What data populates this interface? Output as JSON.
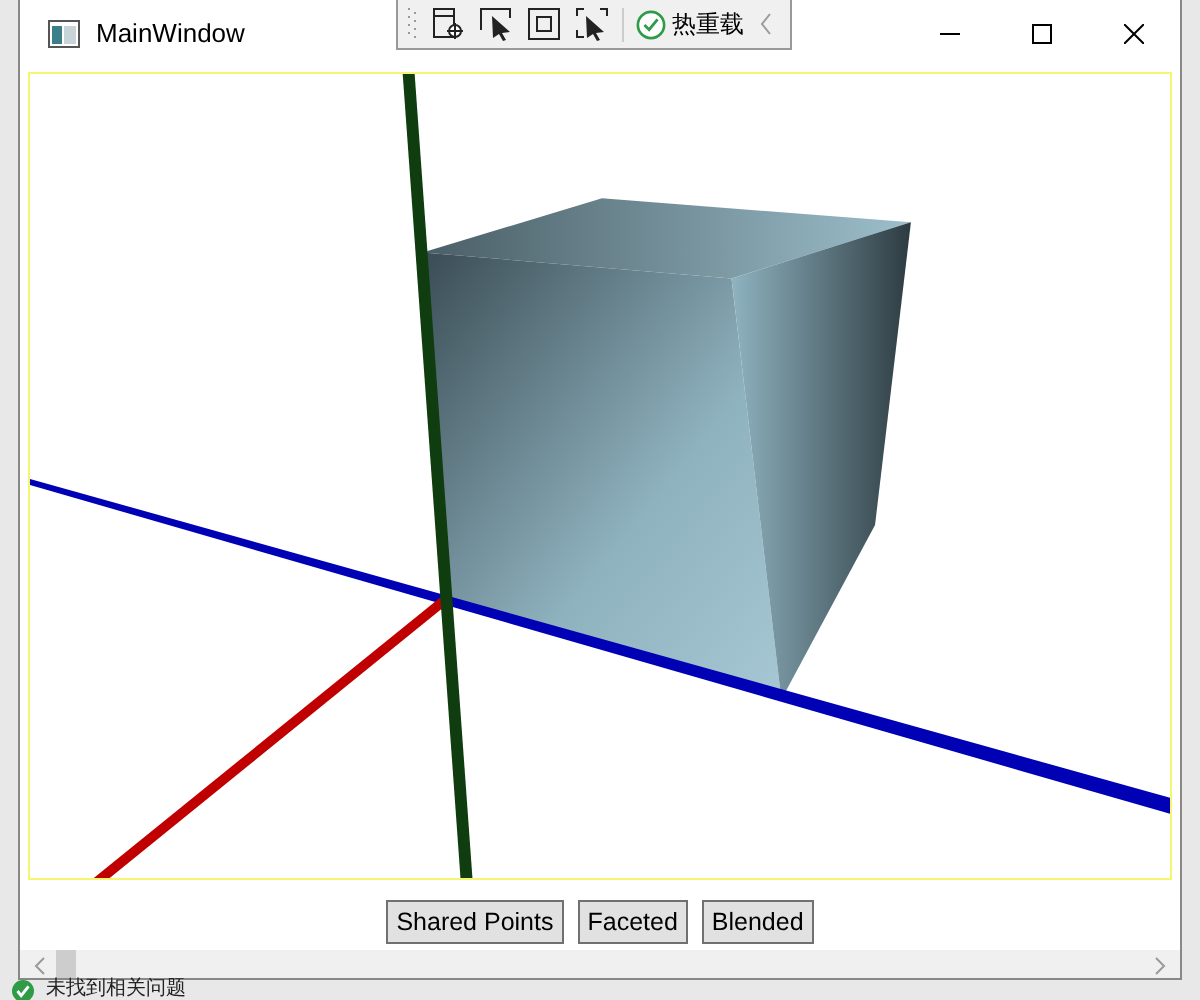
{
  "window": {
    "title": "MainWindow"
  },
  "debug_toolbar": {
    "hot_reload": "热重载"
  },
  "buttons": [
    {
      "label": "Shared Points"
    },
    {
      "label": "Faceted"
    },
    {
      "label": "Blended"
    }
  ],
  "status_bar": {
    "text": "未找到相关问题"
  }
}
